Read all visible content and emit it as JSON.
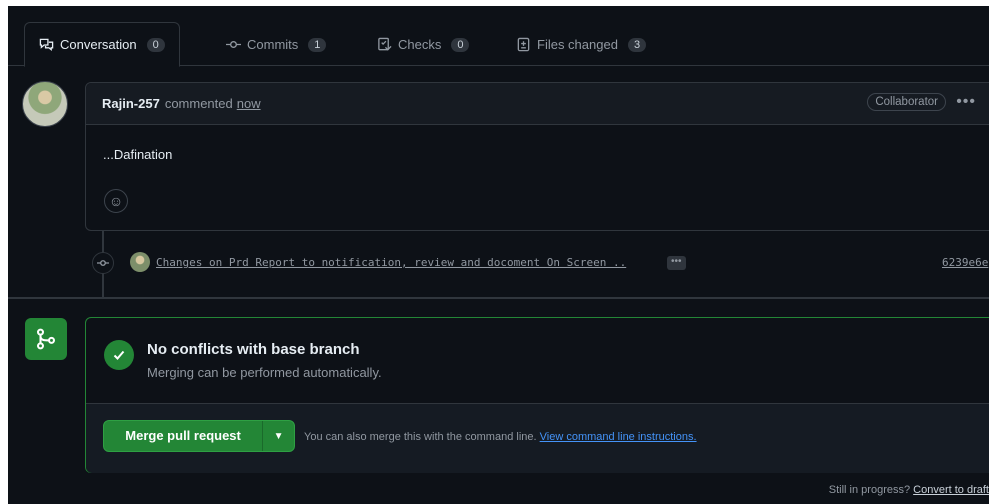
{
  "tabs": [
    {
      "label": "Conversation",
      "count": "0",
      "icon": "comment-discussion-icon"
    },
    {
      "label": "Commits",
      "count": "1",
      "icon": "git-commit-icon"
    },
    {
      "label": "Checks",
      "count": "0",
      "icon": "checklist-icon"
    },
    {
      "label": "Files changed",
      "count": "3",
      "icon": "file-diff-icon"
    }
  ],
  "comment": {
    "author": "Rajin-257",
    "verb": "commented",
    "time": "now",
    "role_badge": "Collaborator",
    "more": "•••",
    "body": "...Dafination",
    "emoji": "☺"
  },
  "commit": {
    "message": "Changes on Prd Report to notification, review and docoment On Screen ..",
    "more": "•••",
    "sha": "6239e6e"
  },
  "merge": {
    "status_title": "No conflicts with base branch",
    "status_subtitle": "Merging can be performed automatically.",
    "button_label": "Merge pull request",
    "caret": "▼",
    "cli_text": "You can also merge this with the command line.",
    "cli_link": "View command line instructions."
  },
  "footer": {
    "text": "Still in progress?",
    "link": "Convert to draft"
  },
  "colors": {
    "background": "#0d1117",
    "accent_green": "#238636",
    "link_blue": "#4493f8",
    "muted": "#9198a1"
  }
}
